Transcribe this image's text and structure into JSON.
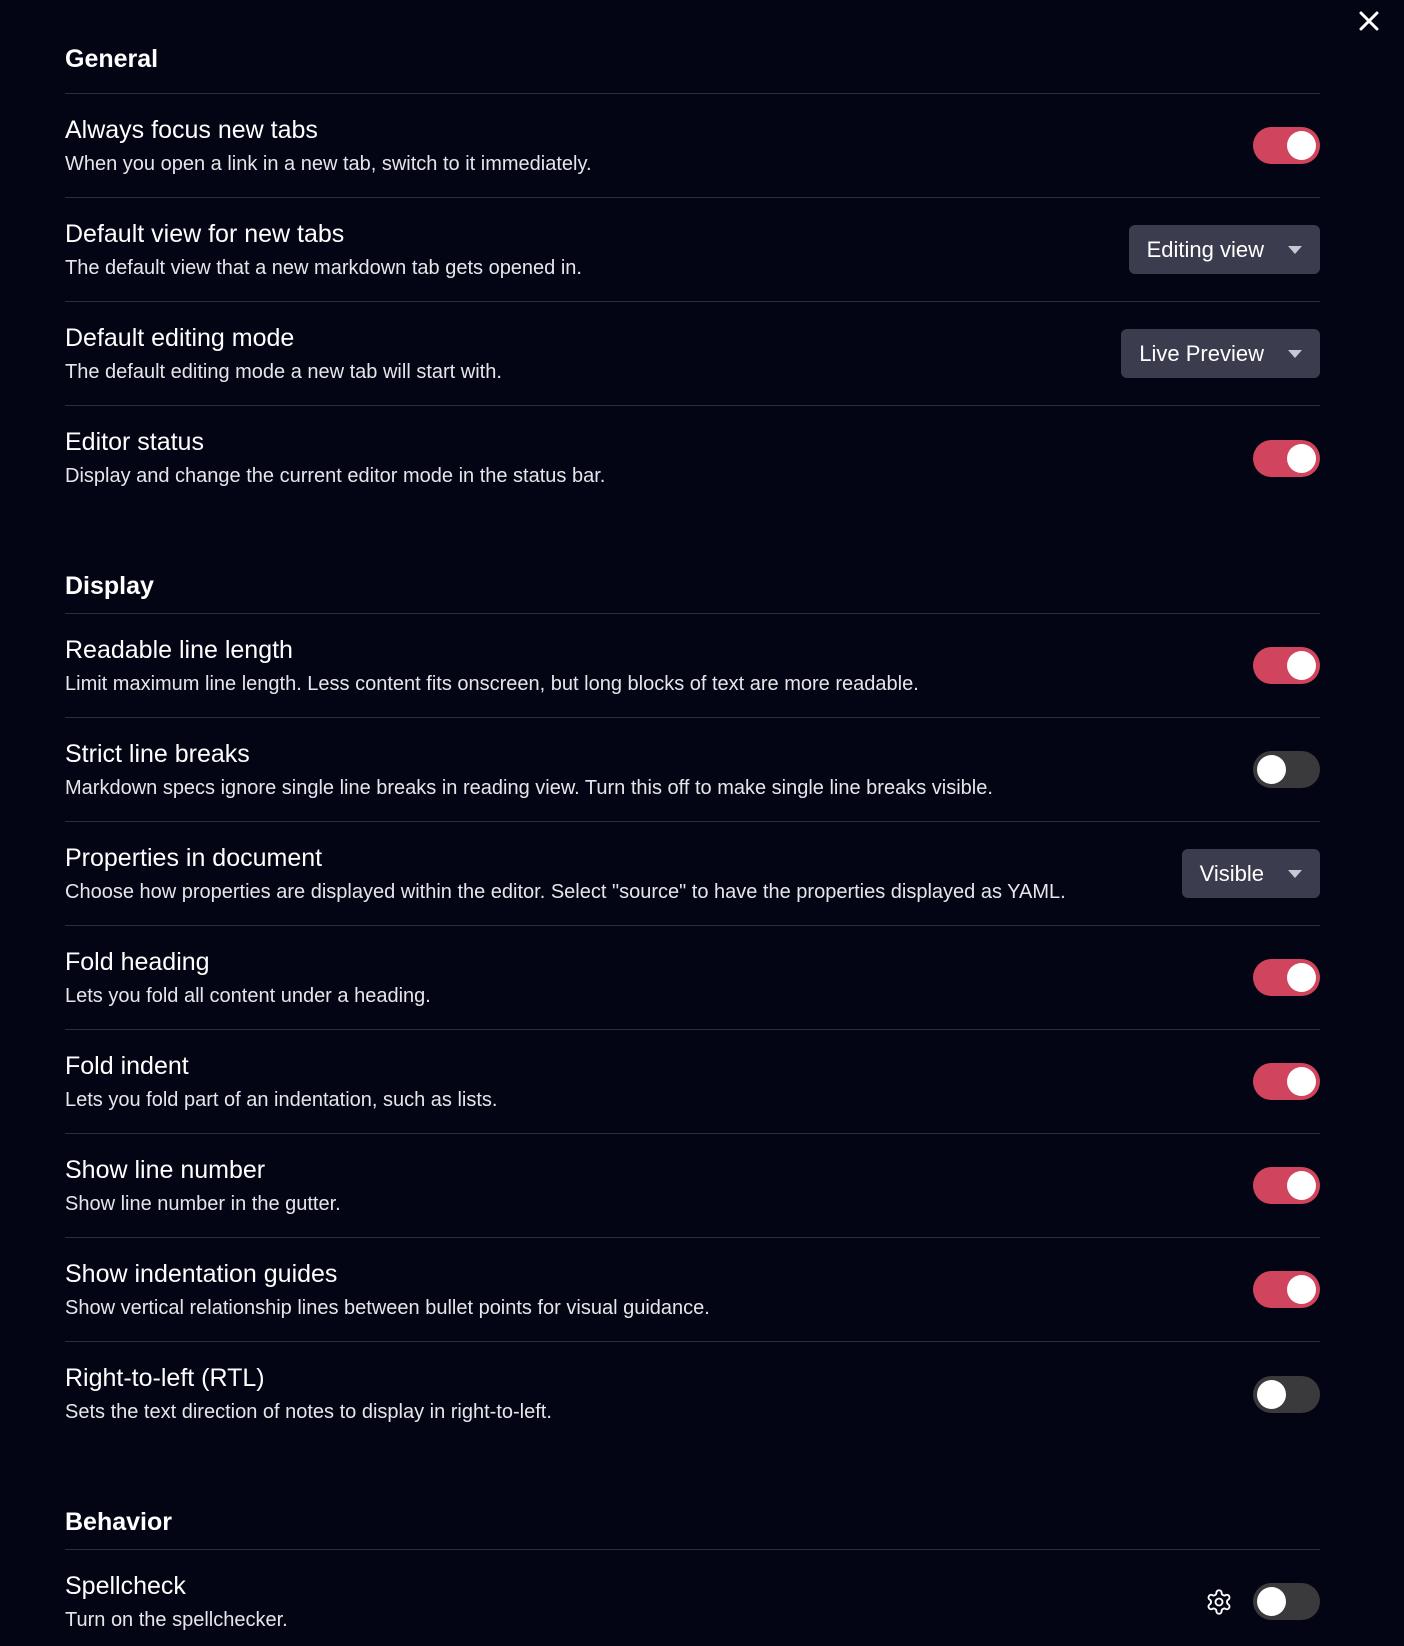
{
  "close_icon": "close-icon",
  "sections": {
    "general": {
      "heading": "General",
      "always_focus": {
        "name": "Always focus new tabs",
        "desc": "When you open a link in a new tab, switch to it immediately.",
        "enabled": true
      },
      "default_view": {
        "name": "Default view for new tabs",
        "desc": "The default view that a new markdown tab gets opened in.",
        "value": "Editing view"
      },
      "default_mode": {
        "name": "Default editing mode",
        "desc": "The default editing mode a new tab will start with.",
        "value": "Live Preview"
      },
      "editor_status": {
        "name": "Editor status",
        "desc": "Display and change the current editor mode in the status bar.",
        "enabled": true
      }
    },
    "display": {
      "heading": "Display",
      "readable_line": {
        "name": "Readable line length",
        "desc": "Limit maximum line length. Less content fits onscreen, but long blocks of text are more readable.",
        "enabled": true
      },
      "strict_breaks": {
        "name": "Strict line breaks",
        "desc": "Markdown specs ignore single line breaks in reading view. Turn this off to make single line breaks visible.",
        "enabled": false
      },
      "properties": {
        "name": "Properties in document",
        "desc": "Choose how properties are displayed within the editor. Select \"source\" to have the properties displayed as YAML.",
        "value": "Visible"
      },
      "fold_heading": {
        "name": "Fold heading",
        "desc": "Lets you fold all content under a heading.",
        "enabled": true
      },
      "fold_indent": {
        "name": "Fold indent",
        "desc": "Lets you fold part of an indentation, such as lists.",
        "enabled": true
      },
      "line_number": {
        "name": "Show line number",
        "desc": "Show line number in the gutter.",
        "enabled": true
      },
      "indent_guides": {
        "name": "Show indentation guides",
        "desc": "Show vertical relationship lines between bullet points for visual guidance.",
        "enabled": true
      },
      "rtl": {
        "name": "Right-to-left (RTL)",
        "desc": "Sets the text direction of notes to display in right-to-left.",
        "enabled": false
      }
    },
    "behavior": {
      "heading": "Behavior",
      "spellcheck": {
        "name": "Spellcheck",
        "desc": "Turn on the spellchecker.",
        "enabled": false,
        "settings_icon": "gear-icon"
      }
    }
  },
  "colors": {
    "background": "#030515",
    "toggle_on": "#d0445d",
    "toggle_off": "#3a3a3c",
    "dropdown_bg": "#3b3d4f"
  }
}
